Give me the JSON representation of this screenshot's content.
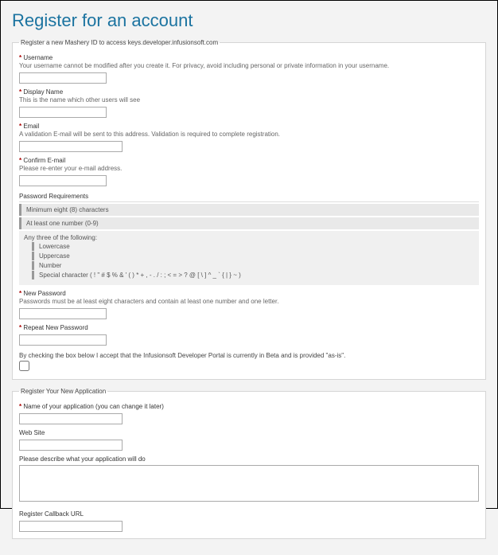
{
  "title": "Register for an account",
  "section1": {
    "legend": "Register a new Mashery ID to access keys.developer.infusionsoft.com",
    "username": {
      "label": "Username",
      "hint": "Your username cannot be modified after you create it. For privacy, avoid including personal or private information in your username."
    },
    "displayName": {
      "label": "Display Name",
      "hint": "This is the name which other users will see"
    },
    "email": {
      "label": "Email",
      "hint": "A validation E-mail will be sent to this address. Validation is required to complete registration."
    },
    "confirmEmail": {
      "label": "Confirm E-mail",
      "hint": "Please re-enter your e-mail address."
    },
    "pwReqTitle": "Password Requirements",
    "rule1": "Minimum eight (8) characters",
    "rule2": "At least one number (0-9)",
    "rule3Intro": "Any three of the following:",
    "rule3a": "Lowercase",
    "rule3b": "Uppercase",
    "rule3c": "Number",
    "rule3d": "Special character (   ! \" # $ % & ' ( ) * + , - . / : ; < = > ? @ [ \\ ] ^ _ ` { | } ~ )",
    "newPassword": {
      "label": "New Password",
      "hint": "Passwords must be at least eight characters and contain at least one number and one letter."
    },
    "repeatPassword": {
      "label": "Repeat New Password"
    },
    "acceptText": "By checking the box below I accept that the Infusionsoft Developer Portal is currently in Beta and is provided \"as-is\"."
  },
  "section2": {
    "legend": "Register Your New Application",
    "appName": {
      "label": "Name of your application (you can change it later)"
    },
    "website": {
      "label": "Web Site"
    },
    "describe": {
      "label": "Please describe what your application will do"
    },
    "callback": {
      "label": "Register Callback URL"
    }
  }
}
